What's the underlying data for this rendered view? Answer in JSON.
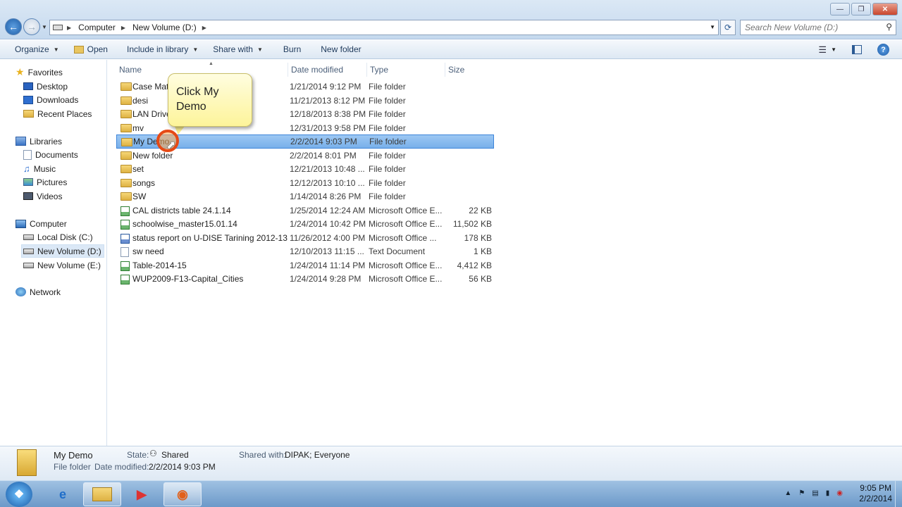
{
  "address": {
    "crumbs": [
      "Computer",
      "New Volume (D:)"
    ],
    "search_placeholder": "Search New Volume (D:)"
  },
  "toolbar": {
    "organize": "Organize",
    "open": "Open",
    "include_in_library": "Include in library",
    "share_with": "Share with",
    "burn": "Burn",
    "new_folder": "New folder"
  },
  "nav": {
    "favorites": "Favorites",
    "desktop": "Desktop",
    "downloads": "Downloads",
    "recent_places": "Recent Places",
    "libraries": "Libraries",
    "documents": "Documents",
    "music": "Music",
    "pictures": "Pictures",
    "videos": "Videos",
    "computer": "Computer",
    "local_disk_c": "Local Disk (C:)",
    "new_volume_d": "New Volume (D:)",
    "new_volume_e": "New Volume (E:)",
    "network": "Network"
  },
  "columns": {
    "name": "Name",
    "date_modified": "Date modified",
    "type": "Type",
    "size": "Size"
  },
  "files": [
    {
      "name": "Case Matt",
      "date": "1/21/2014 9:12 PM",
      "type": "File folder",
      "size": "",
      "icon": "folder-icon"
    },
    {
      "name": "desi",
      "date": "11/21/2013 8:12 PM",
      "type": "File folder",
      "size": "",
      "icon": "folder-icon"
    },
    {
      "name": "LAN Drive",
      "date": "12/18/2013 8:38 PM",
      "type": "File folder",
      "size": "",
      "icon": "folder-icon"
    },
    {
      "name": "mv",
      "date": "12/31/2013 9:58 PM",
      "type": "File folder",
      "size": "",
      "icon": "folder-icon"
    },
    {
      "name": "My Demo",
      "date": "2/2/2014 9:03 PM",
      "type": "File folder",
      "size": "",
      "icon": "folder-icon"
    },
    {
      "name": "New folder",
      "date": "2/2/2014 8:01 PM",
      "type": "File folder",
      "size": "",
      "icon": "folder-icon"
    },
    {
      "name": "set",
      "date": "12/21/2013 10:48 ...",
      "type": "File folder",
      "size": "",
      "icon": "folder-icon"
    },
    {
      "name": "songs",
      "date": "12/12/2013 10:10 ...",
      "type": "File folder",
      "size": "",
      "icon": "folder-icon"
    },
    {
      "name": "SW",
      "date": "1/14/2014 8:26 PM",
      "type": "File folder",
      "size": "",
      "icon": "folder-icon"
    },
    {
      "name": "CAL districts table 24.1.14",
      "date": "1/25/2014 12:24 AM",
      "type": "Microsoft Office E...",
      "size": "22 KB",
      "icon": "excel-icon"
    },
    {
      "name": "schoolwise_master15.01.14",
      "date": "1/24/2014 10:42 PM",
      "type": "Microsoft Office E...",
      "size": "11,502 KB",
      "icon": "excel-icon"
    },
    {
      "name": "status report on U-DISE Tarining 2012-13",
      "date": "11/26/2012 4:00 PM",
      "type": "Microsoft Office ...",
      "size": "178 KB",
      "icon": "word-icon"
    },
    {
      "name": "sw need",
      "date": "12/10/2013 11:15 ...",
      "type": "Text Document",
      "size": "1 KB",
      "icon": "text-file-icon"
    },
    {
      "name": "Table-2014-15",
      "date": "1/24/2014 11:14 PM",
      "type": "Microsoft Office E...",
      "size": "4,412 KB",
      "icon": "excel-icon"
    },
    {
      "name": "WUP2009-F13-Capital_Cities",
      "date": "1/24/2014 9:28 PM",
      "type": "Microsoft Office E...",
      "size": "56 KB",
      "icon": "excel-icon"
    }
  ],
  "selected_index": 4,
  "callout": {
    "line1": "Click My",
    "line2": "Demo"
  },
  "details": {
    "name": "My Demo",
    "kind": "File folder",
    "state_label": "State:",
    "state_value": "Shared",
    "shared_with_label": "Shared with:",
    "shared_with_value": "DIPAK; Everyone",
    "date_modified_label": "Date modified:",
    "date_modified_value": "2/2/2014 9:03 PM"
  },
  "clock": {
    "time": "9:05 PM",
    "date": "2/2/2014"
  },
  "colors": {
    "selection": "#78b0ea",
    "callout": "#fdf49a",
    "accent": "#1f5fa8"
  }
}
